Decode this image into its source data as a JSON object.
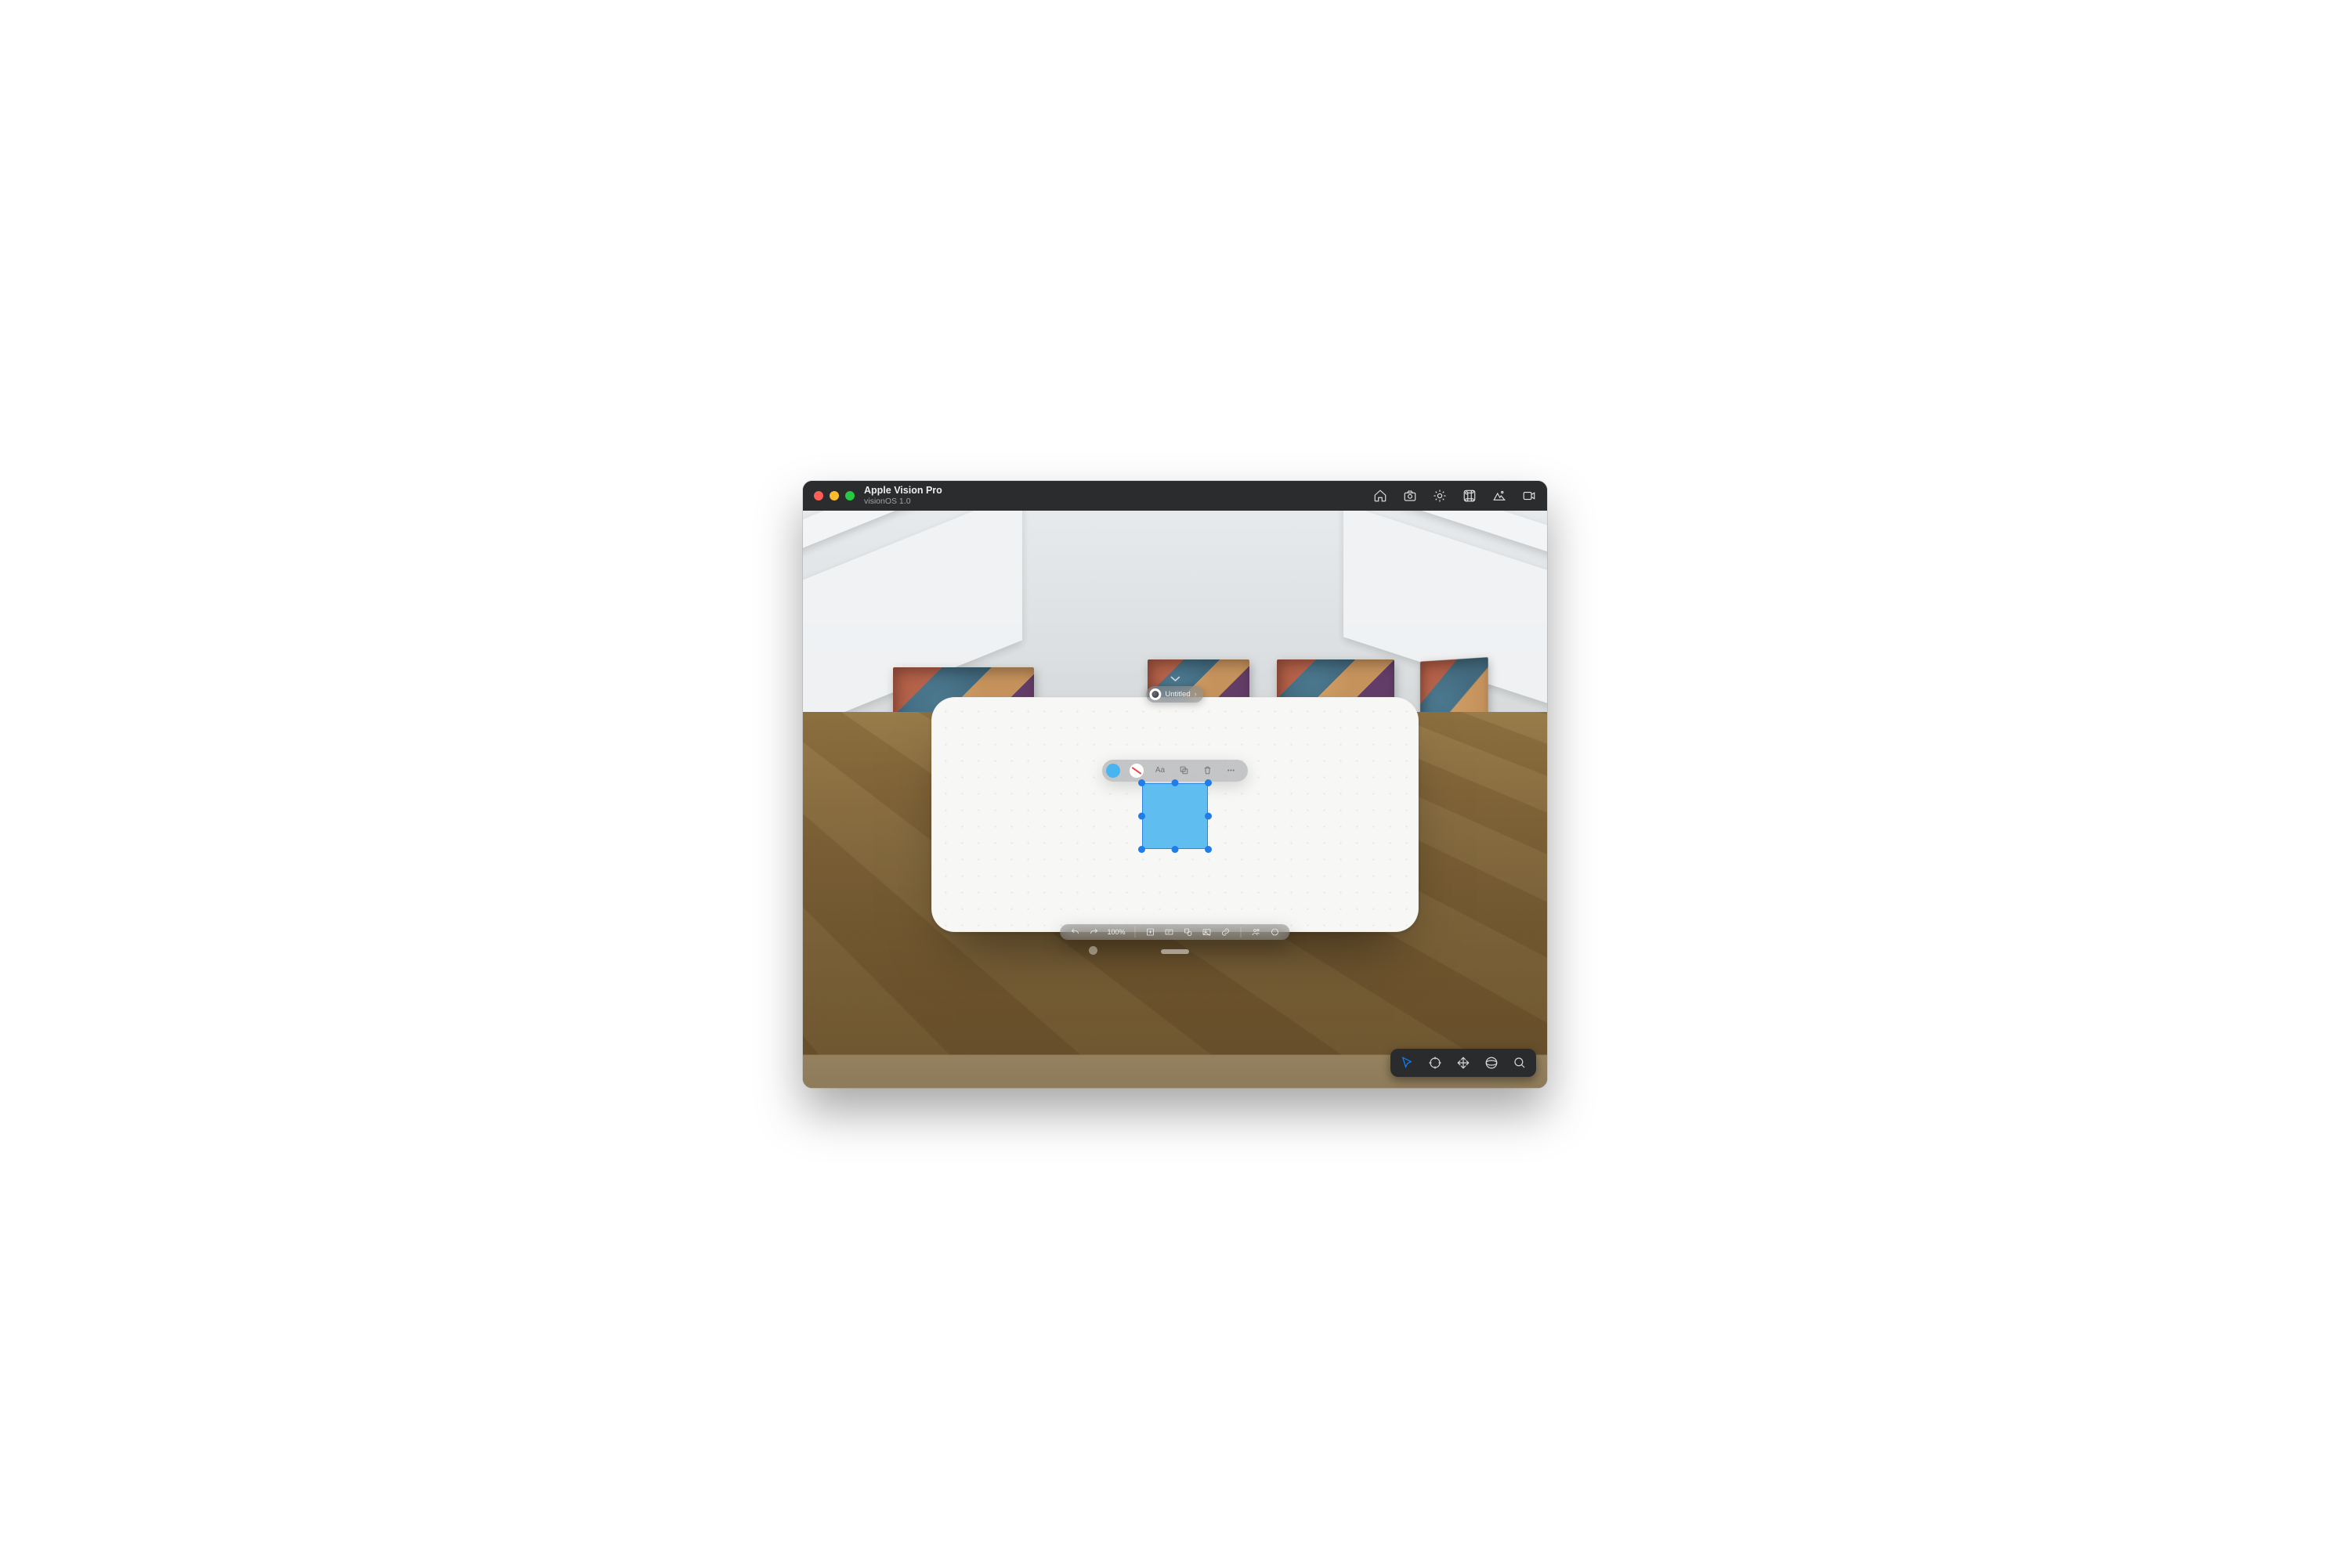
{
  "titlebar": {
    "title": "Apple Vision Pro",
    "subtitle": "visionOS 1.0"
  },
  "titlebar_icons": {
    "home": "home-icon",
    "camera": "camera-icon",
    "brightness": "brightness-icon",
    "shortcuts": "command-icon",
    "environment": "mountains-icon",
    "record": "record-icon"
  },
  "document": {
    "name": "Untitled"
  },
  "shape_toolbar": {
    "text_label": "Aa",
    "fill_color": "#49b5f0"
  },
  "selected_shape": {
    "type": "square",
    "fill": "#5fbdf0",
    "stroke": "#2d86e6"
  },
  "canvas_toolbar": {
    "zoom": "100%"
  },
  "sim_toolbar": {
    "tools": [
      "pointer",
      "target",
      "pan",
      "orbit",
      "zoom"
    ],
    "active": "pointer"
  }
}
